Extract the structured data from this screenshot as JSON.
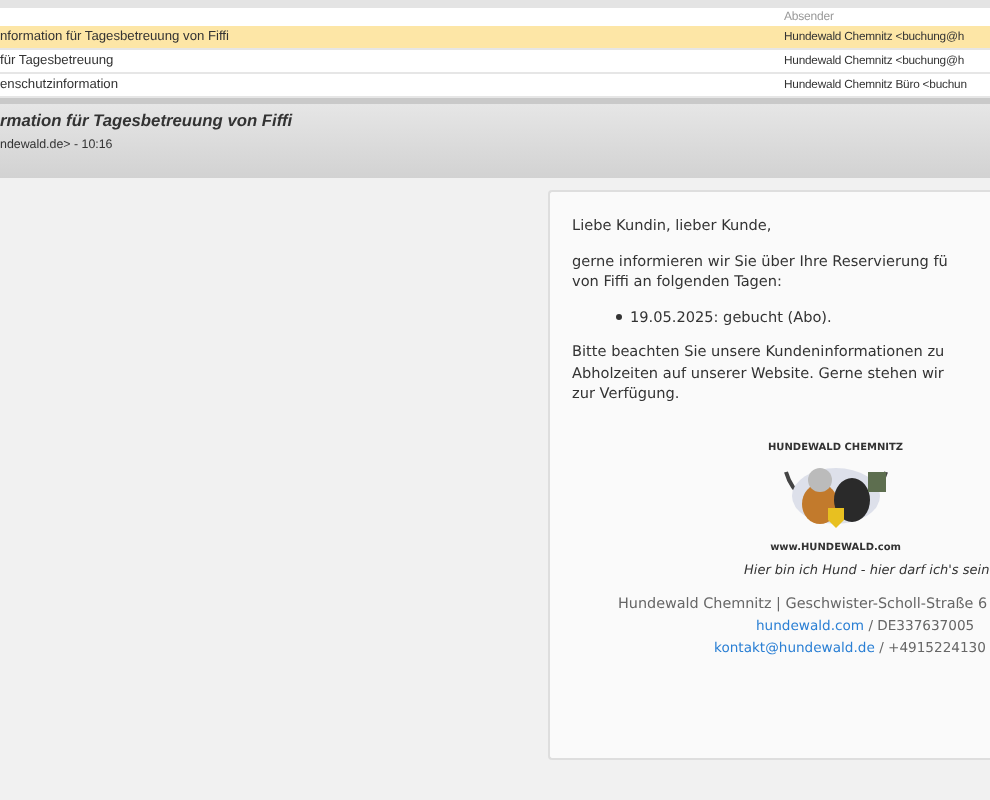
{
  "message_list": {
    "columns": [
      {
        "label": "Absender"
      }
    ],
    "rows": [
      {
        "subject": "nformation für Tagesbetreuung von Fiffi",
        "sender": "Hundewald Chemnitz <buchung@h",
        "selected": true
      },
      {
        "subject": "für Tagesbetreuung",
        "sender": "Hundewald Chemnitz <buchung@h",
        "selected": false
      },
      {
        "subject": "enschutzinformation",
        "sender": "Hundewald Chemnitz Büro <buchun",
        "selected": false
      }
    ]
  },
  "preview_header": {
    "subject": "rmation für Tagesbetreuung von Fiffi",
    "from_line": "ndewald.de> - 10:16"
  },
  "message": {
    "greeting": "Liebe Kundin, lieber Kunde,",
    "intro_lines": [
      "gerne informieren wir Sie über Ihre Reservierung fü",
      "von Fiffi an folgenden Tagen:"
    ],
    "bookings": [
      "19.05.2025: gebucht (Abo)."
    ],
    "note_lines": [
      "Bitte beachten Sie unsere Kundeninformationen zu",
      "Abholzeiten auf unserer Website. Gerne stehen wir",
      "zur Verfügung."
    ],
    "logo": {
      "top_text": "HUNDEWALD CHEMNITZ",
      "bottom_text": "www.HUNDEWALD.com"
    },
    "tagline": "Hier bin ich Hund - hier darf ich's sein",
    "address": "Hundewald Chemnitz | Geschwister-Scholl-Straße 6",
    "web_link": "hundewald.com",
    "web_suffix": " / DE337637005",
    "email_link": "kontakt@hundewald.de",
    "email_suffix": " / +4915224130"
  }
}
